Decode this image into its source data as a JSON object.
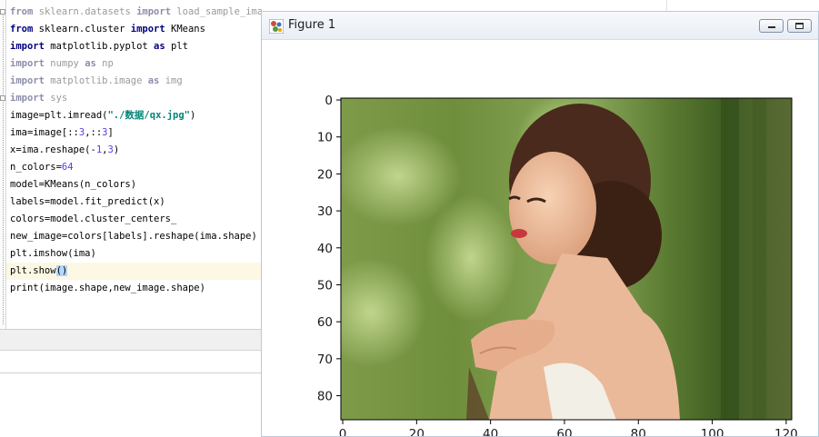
{
  "editor": {
    "lines": [
      {
        "parts": [
          {
            "t": "from",
            "c": "kw"
          },
          {
            "t": " sklearn.datasets "
          },
          {
            "t": "import",
            "c": "kw"
          },
          {
            "t": " load_sample_image"
          }
        ],
        "dim": true
      },
      {
        "parts": [
          {
            "t": "from",
            "c": "kw"
          },
          {
            "t": " sklearn.cluster "
          },
          {
            "t": "import",
            "c": "kw"
          },
          {
            "t": " KMeans"
          }
        ]
      },
      {
        "parts": [
          {
            "t": "import",
            "c": "kw"
          },
          {
            "t": " matplotlib.pyplot "
          },
          {
            "t": "as",
            "c": "kw"
          },
          {
            "t": " plt"
          }
        ]
      },
      {
        "parts": [
          {
            "t": "import",
            "c": "kw"
          },
          {
            "t": " numpy "
          },
          {
            "t": "as",
            "c": "kw"
          },
          {
            "t": " np"
          }
        ],
        "dim": true
      },
      {
        "parts": [
          {
            "t": "import",
            "c": "kw"
          },
          {
            "t": " matplotlib.image "
          },
          {
            "t": "as",
            "c": "kw"
          },
          {
            "t": " img"
          }
        ],
        "dim": true
      },
      {
        "parts": [
          {
            "t": "import",
            "c": "kw"
          },
          {
            "t": " sys"
          }
        ],
        "dim": true
      },
      {
        "parts": [
          {
            "t": "image=plt.imread("
          },
          {
            "t": "\"./数据/qx.jpg\"",
            "c": "str"
          },
          {
            "t": ")"
          }
        ]
      },
      {
        "parts": [
          {
            "t": "ima=image[::"
          },
          {
            "t": "3",
            "c": "num"
          },
          {
            "t": ",::"
          },
          {
            "t": "3",
            "c": "num"
          },
          {
            "t": "]"
          }
        ]
      },
      {
        "parts": [
          {
            "t": "x=ima.reshape(-"
          },
          {
            "t": "1",
            "c": "num"
          },
          {
            "t": ","
          },
          {
            "t": "3",
            "c": "num"
          },
          {
            "t": ")"
          }
        ]
      },
      {
        "parts": [
          {
            "t": "n_colors="
          },
          {
            "t": "64",
            "c": "num"
          }
        ]
      },
      {
        "parts": [
          {
            "t": "model=KMeans(n_colors)"
          }
        ]
      },
      {
        "parts": [
          {
            "t": "labels=model.fit_predict(x)"
          }
        ]
      },
      {
        "parts": [
          {
            "t": "colors=model.cluster_centers_"
          }
        ]
      },
      {
        "parts": [
          {
            "t": "new_image=colors[labels].reshape(ima.shape)"
          }
        ]
      },
      {
        "parts": [
          {
            "t": "plt.imshow(ima)"
          }
        ]
      },
      {
        "parts": [
          {
            "t": "plt.show"
          },
          {
            "t": "()",
            "c": "brace-hl"
          }
        ],
        "current": true
      },
      {
        "parts": [
          {
            "t": "print(image.shape,new_image.shape)"
          }
        ]
      }
    ]
  },
  "figure_window": {
    "title": "Figure 1",
    "icon": "matplotlib-figure-icon",
    "buttons": [
      "minimize",
      "maximize"
    ]
  },
  "plot": {
    "x_ticks": [
      0,
      20,
      40,
      60,
      80,
      100,
      120
    ],
    "y_ticks": [
      0,
      10,
      20,
      30,
      40,
      50,
      60,
      70,
      80
    ],
    "xlim": [
      -0.5,
      121.5
    ],
    "ylim": [
      86.5,
      -0.5
    ],
    "image_description_colors": {
      "foliage_dark": "#4b6a2c",
      "foliage_light": "#9dbb6a",
      "skin": "#e9b999",
      "hair": "#4a2a1c",
      "dress": "#f2efe6"
    }
  }
}
